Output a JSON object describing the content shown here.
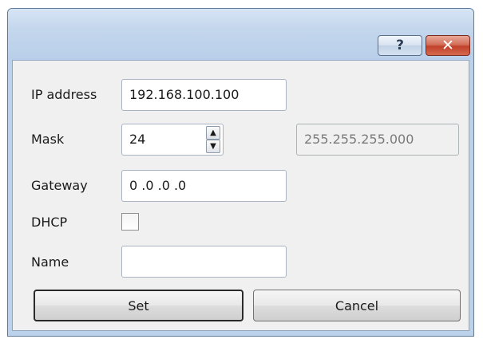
{
  "title_bar": {
    "help_glyph": "?",
    "close_glyph": "✕"
  },
  "form": {
    "ip": {
      "label": "IP address",
      "value": "192.168.100.100"
    },
    "mask": {
      "label": "Mask",
      "value": "24",
      "display": "255.255.255.000"
    },
    "gateway": {
      "label": "Gateway",
      "value": "0  .0  .0  .0"
    },
    "dhcp": {
      "label": "DHCP",
      "checked": false
    },
    "name": {
      "label": "Name",
      "value": ""
    }
  },
  "buttons": {
    "set": "Set",
    "cancel": "Cancel"
  }
}
